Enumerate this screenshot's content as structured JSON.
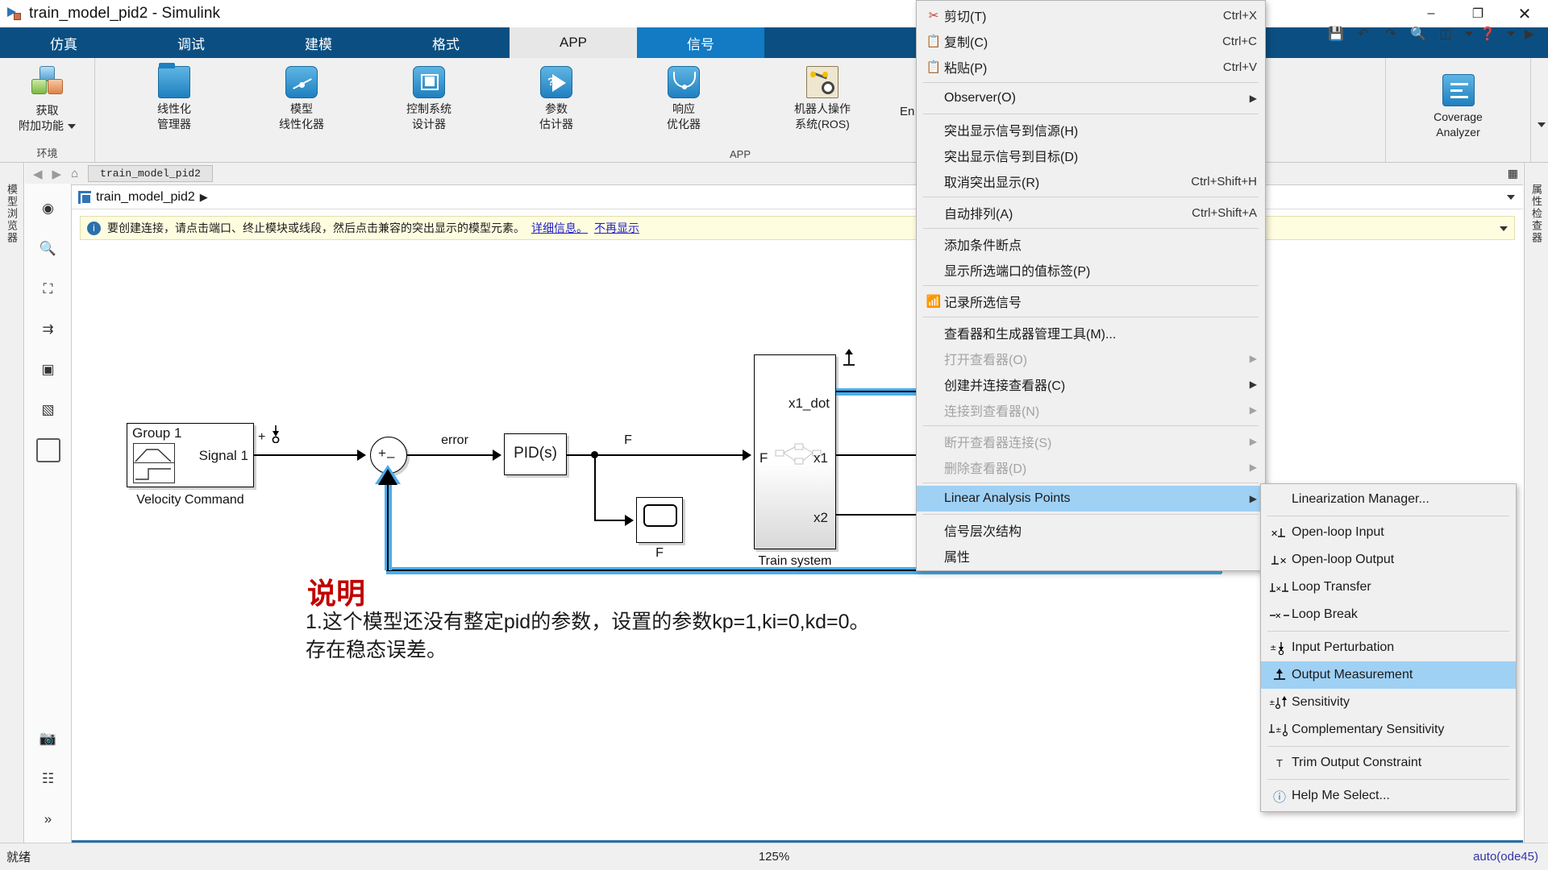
{
  "window": {
    "title": "train_model_pid2 - Simulink",
    "app_icon": "simulink-icon",
    "minimize": "–",
    "maximize": "❐",
    "close": "✕"
  },
  "ribbon": {
    "tabs": [
      {
        "label": "仿真",
        "state": "normal"
      },
      {
        "label": "调试",
        "state": "normal"
      },
      {
        "label": "建模",
        "state": "normal"
      },
      {
        "label": "格式",
        "state": "normal"
      },
      {
        "label": "APP",
        "state": "active"
      },
      {
        "label": "信号",
        "state": "alt"
      }
    ],
    "env_group": {
      "label": "环境",
      "button": {
        "line1": "获取",
        "line2": "附加功能"
      }
    },
    "app_group": {
      "label": "APP",
      "buttons": [
        {
          "line1": "线性化",
          "line2": "管理器",
          "icon": "linearization-manager-icon"
        },
        {
          "line1": "模型",
          "line2": "线性化器",
          "icon": "model-linearizer-icon"
        },
        {
          "line1": "控制系统",
          "line2": "设计器",
          "icon": "control-system-designer-icon"
        },
        {
          "line1": "参数",
          "line2": "估计器",
          "icon": "parameter-estimator-icon"
        },
        {
          "line1": "响应",
          "line2": "优化器",
          "icon": "response-optimizer-icon"
        },
        {
          "line1": "机器人操作",
          "line2": "系统(ROS)",
          "icon": "ros-icon"
        }
      ],
      "truncated_label": "En",
      "coverage": {
        "line1": "Coverage",
        "line2": "Analyzer",
        "icon": "coverage-analyzer-icon"
      }
    },
    "quick_access": [
      "save-icon",
      "undo-icon",
      "redo-icon",
      "search-icon",
      "layout-icon",
      "help-icon",
      "run-icon"
    ]
  },
  "navbar": {
    "back": "◀",
    "forward": "▶",
    "up": "⌂",
    "path_chip": "train_model_pid2"
  },
  "strips": {
    "left_label": "模型浏览器",
    "right_label": "属性检查器"
  },
  "toolbar_icons": [
    "pan-icon",
    "zoom-icon",
    "fit-to-view-icon",
    "signal-icon",
    "annotation-icon",
    "image-icon",
    "rectangle-icon",
    "snapshot-icon",
    "notes-icon",
    "expand-icon"
  ],
  "breadcrumb": {
    "model_name": "train_model_pid2",
    "separator": "▶"
  },
  "notice": {
    "icon": "info-icon",
    "text": "要创建连接，请点击端口、终止模块或线段，然后点击兼容的突出显示的模型元素。",
    "link1": "详细信息。",
    "link2": "不再显示"
  },
  "model": {
    "blocks": [
      {
        "name": "velocity-command-block",
        "title": "Group 1",
        "port_label": "Signal 1",
        "caption": "Velocity Command"
      },
      {
        "name": "sum-block",
        "plus": "+",
        "minus": "–"
      },
      {
        "name": "pid-block",
        "label": "PID(s)"
      },
      {
        "name": "scope-block",
        "caption": "F"
      },
      {
        "name": "train-system-block",
        "in_label": "F",
        "out1": "x1_dot",
        "out2": "x1",
        "out3": "x2",
        "caption": "Train system"
      }
    ],
    "signal_labels": [
      "error",
      "F"
    ],
    "annotation": {
      "title": "说明",
      "body": "1.这个模型还没有整定pid的参数，设置的参数kp=1,ki=0,kd=0。\n存在稳态误差。"
    }
  },
  "context_menu": {
    "items": [
      {
        "label": "剪切(T)",
        "accel": "Ctrl+X",
        "icon": "cut-icon",
        "type": "item"
      },
      {
        "label": "复制(C)",
        "accel": "Ctrl+C",
        "icon": "copy-icon",
        "type": "item"
      },
      {
        "label": "粘贴(P)",
        "accel": "Ctrl+V",
        "icon": "paste-icon",
        "type": "item"
      },
      {
        "type": "separator"
      },
      {
        "label": "Observer(O)",
        "accel": "",
        "icon": "",
        "type": "submenu"
      },
      {
        "type": "separator"
      },
      {
        "label": "突出显示信号到信源(H)",
        "accel": "",
        "icon": "",
        "type": "item"
      },
      {
        "label": "突出显示信号到目标(D)",
        "accel": "",
        "icon": "",
        "type": "item"
      },
      {
        "label": "取消突出显示(R)",
        "accel": "Ctrl+Shift+H",
        "icon": "",
        "type": "item"
      },
      {
        "type": "separator"
      },
      {
        "label": "自动排列(A)",
        "accel": "Ctrl+Shift+A",
        "icon": "",
        "type": "item"
      },
      {
        "type": "separator"
      },
      {
        "label": "添加条件断点",
        "accel": "",
        "icon": "",
        "type": "item"
      },
      {
        "label": "显示所选端口的值标签(P)",
        "accel": "",
        "icon": "",
        "type": "item"
      },
      {
        "type": "separator"
      },
      {
        "label": "记录所选信号",
        "accel": "",
        "icon": "log-signal-icon",
        "type": "item"
      },
      {
        "type": "separator"
      },
      {
        "label": "查看器和生成器管理工具(M)...",
        "accel": "",
        "icon": "",
        "type": "item"
      },
      {
        "label": "打开查看器(O)",
        "accel": "",
        "icon": "",
        "type": "submenu",
        "disabled": true
      },
      {
        "label": "创建并连接查看器(C)",
        "accel": "",
        "icon": "",
        "type": "submenu"
      },
      {
        "label": "连接到查看器(N)",
        "accel": "",
        "icon": "",
        "type": "submenu",
        "disabled": true
      },
      {
        "type": "separator"
      },
      {
        "label": "断开查看器连接(S)",
        "accel": "",
        "icon": "",
        "type": "submenu",
        "disabled": true
      },
      {
        "label": "删除查看器(D)",
        "accel": "",
        "icon": "",
        "type": "submenu",
        "disabled": true
      },
      {
        "type": "separator"
      },
      {
        "label": "Linear Analysis Points",
        "accel": "",
        "icon": "",
        "type": "submenu",
        "selected": true
      },
      {
        "type": "separator"
      },
      {
        "label": "信号层次结构",
        "accel": "",
        "icon": "",
        "type": "item"
      },
      {
        "label": "属性",
        "accel": "",
        "icon": "",
        "type": "item"
      }
    ]
  },
  "submenu": {
    "items": [
      {
        "label": "Linearization Manager...",
        "icon": "",
        "type": "item"
      },
      {
        "type": "separator"
      },
      {
        "label": "Open-loop Input",
        "icon": "open-loop-input-icon",
        "type": "item"
      },
      {
        "label": "Open-loop Output",
        "icon": "open-loop-output-icon",
        "type": "item"
      },
      {
        "label": "Loop Transfer",
        "icon": "loop-transfer-icon",
        "type": "item"
      },
      {
        "label": "Loop Break",
        "icon": "loop-break-icon",
        "type": "item"
      },
      {
        "type": "separator"
      },
      {
        "label": "Input Perturbation",
        "icon": "input-perturbation-icon",
        "type": "item"
      },
      {
        "label": "Output Measurement",
        "icon": "output-measurement-icon",
        "type": "item",
        "selected": true
      },
      {
        "label": "Sensitivity",
        "icon": "sensitivity-icon",
        "type": "item"
      },
      {
        "label": "Complementary Sensitivity",
        "icon": "complementary-sensitivity-icon",
        "type": "item"
      },
      {
        "type": "separator"
      },
      {
        "label": "Trim Output Constraint",
        "icon": "trim-output-constraint-icon",
        "type": "item"
      },
      {
        "type": "separator"
      },
      {
        "label": "Help Me Select...",
        "icon": "help-icon",
        "type": "item"
      }
    ]
  },
  "statusbar": {
    "left": "就绪",
    "zoom": "125%",
    "right": "auto(ode45)"
  },
  "colors": {
    "ribbon_blue": "#0b4f82",
    "tab_alt_blue": "#127bc4",
    "highlight_blue": "#9fd1f5",
    "selected_signal": "#4aaded",
    "notice_bg": "#fffde0",
    "annotation_red": "#c00000"
  }
}
